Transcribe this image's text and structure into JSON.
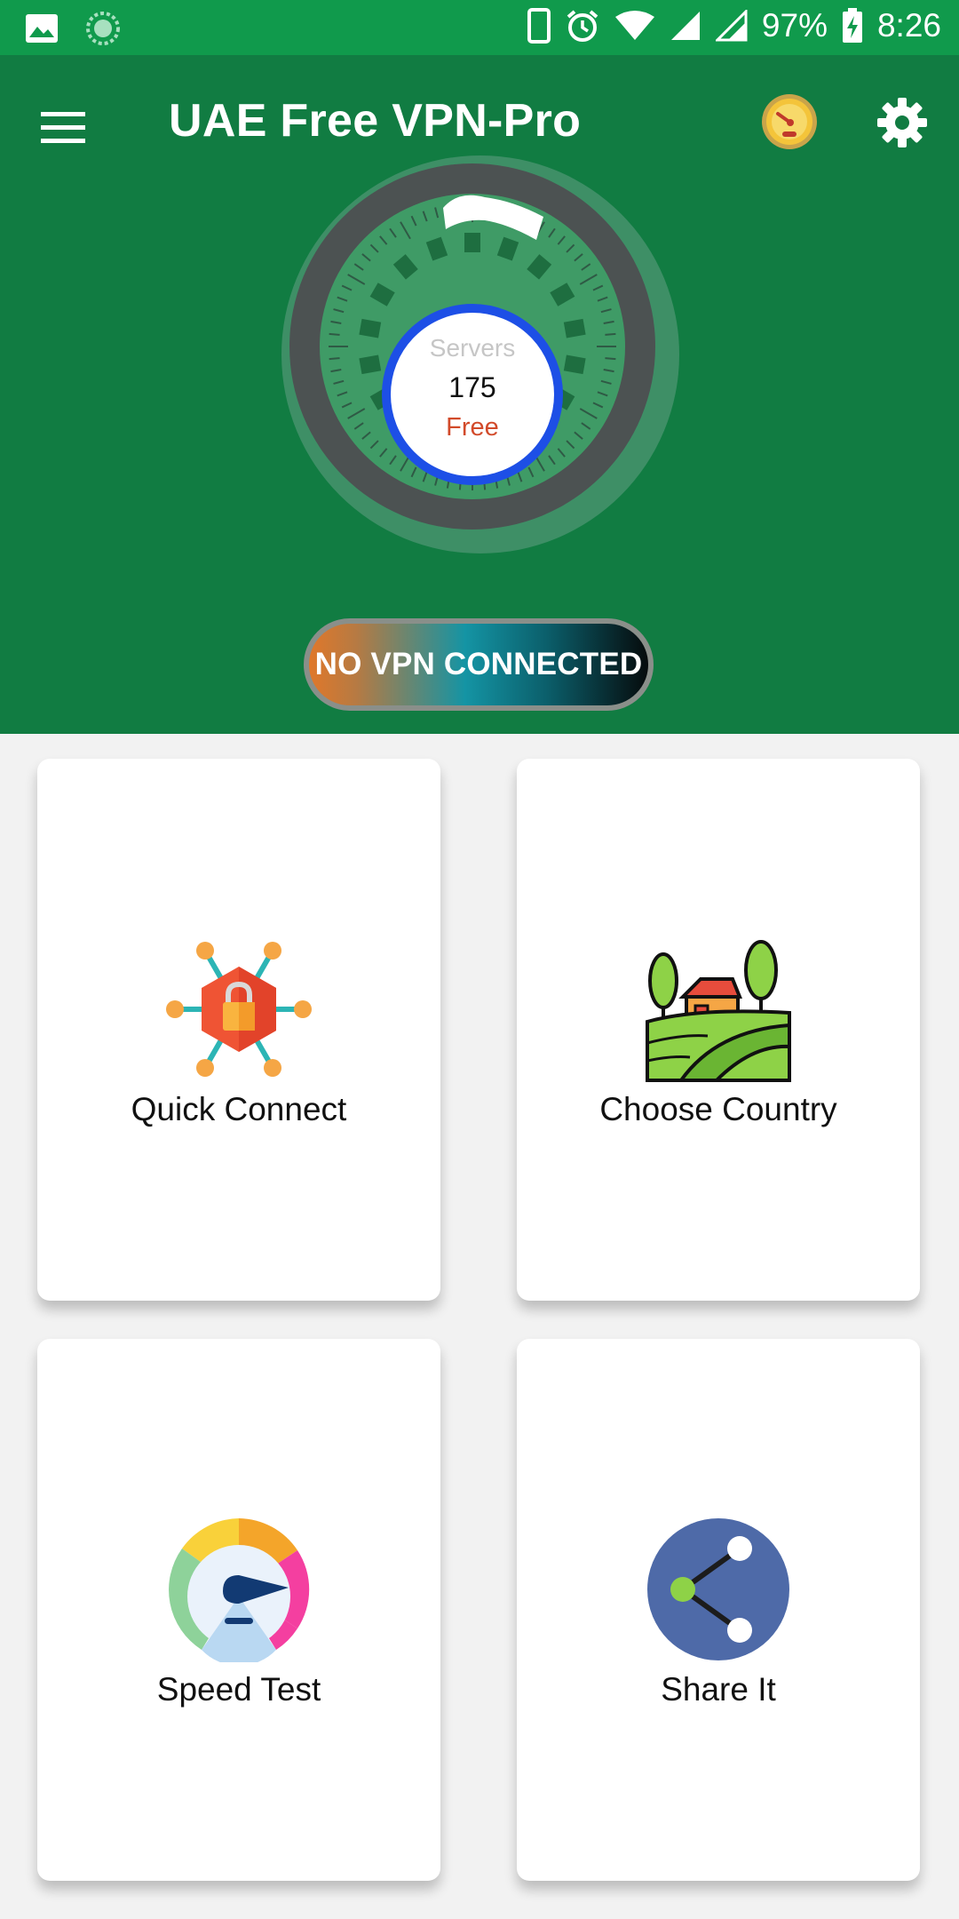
{
  "status_bar": {
    "battery": "97%",
    "time": "8:26",
    "icons": [
      "image-icon",
      "loading-icon",
      "phone-icon",
      "alarm-icon",
      "wifi-icon",
      "signal-icon",
      "signal-icon",
      "battery-charging-icon"
    ]
  },
  "app_bar": {
    "title": "UAE Free VPN-Pro",
    "icons": [
      "menu-icon",
      "speedometer-icon",
      "gear-icon"
    ]
  },
  "servers": {
    "label": "Servers",
    "count": "175",
    "type": "Free"
  },
  "connection_status": "NO VPN CONNECTED",
  "cards": [
    {
      "label": "Quick Connect",
      "icon": "network-lock-icon"
    },
    {
      "label": "Choose Country",
      "icon": "farm-landscape-icon"
    },
    {
      "label": "Speed Test",
      "icon": "speedometer-icon"
    },
    {
      "label": "Share It",
      "icon": "share-icon"
    }
  ],
  "colors": {
    "status_bar": "#109a4c",
    "header": "#117c42",
    "ring": "#1d4fe6",
    "free_text": "#d24a2a"
  }
}
